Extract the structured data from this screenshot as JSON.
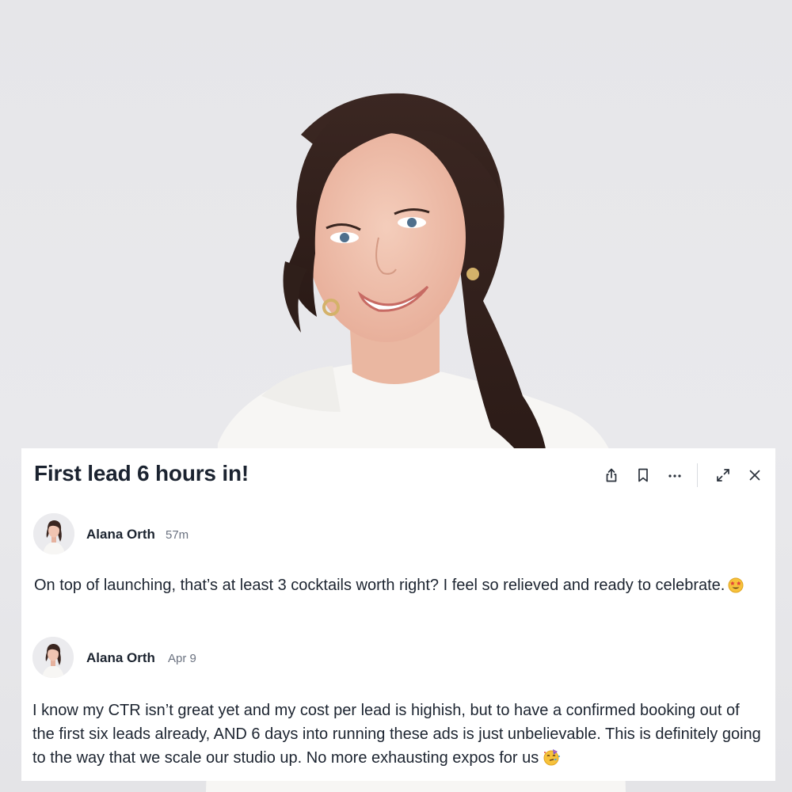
{
  "post": {
    "title": "First lead 6 hours in!"
  },
  "toolbar": {
    "icons": [
      "share-icon",
      "bookmark-icon",
      "more-icon",
      "expand-icon",
      "close-icon"
    ]
  },
  "comments": [
    {
      "author": "Alana Orth",
      "time": "57m",
      "text": "On top of launching, that’s at least 3 cocktails worth right? I feel so relieved and ready to celebrate.",
      "emoji": "star-struck-emoji"
    },
    {
      "author": "Alana Orth",
      "time": "Apr 9",
      "text": "I know my CTR isn’t great yet and my cost per lead is highish, but to have a confirmed booking out of the first six leads already, AND 6 days into running these ads is just unbelievable. This is definitely going to the way that we scale our studio up. No more exhausting expos for us",
      "emoji": "partying-face-emoji"
    }
  ],
  "colors": {
    "text": "#1c2430",
    "muted": "#6b7280",
    "card": "#ffffff",
    "background": "#e9e9ec",
    "hair": "#3a2620"
  }
}
